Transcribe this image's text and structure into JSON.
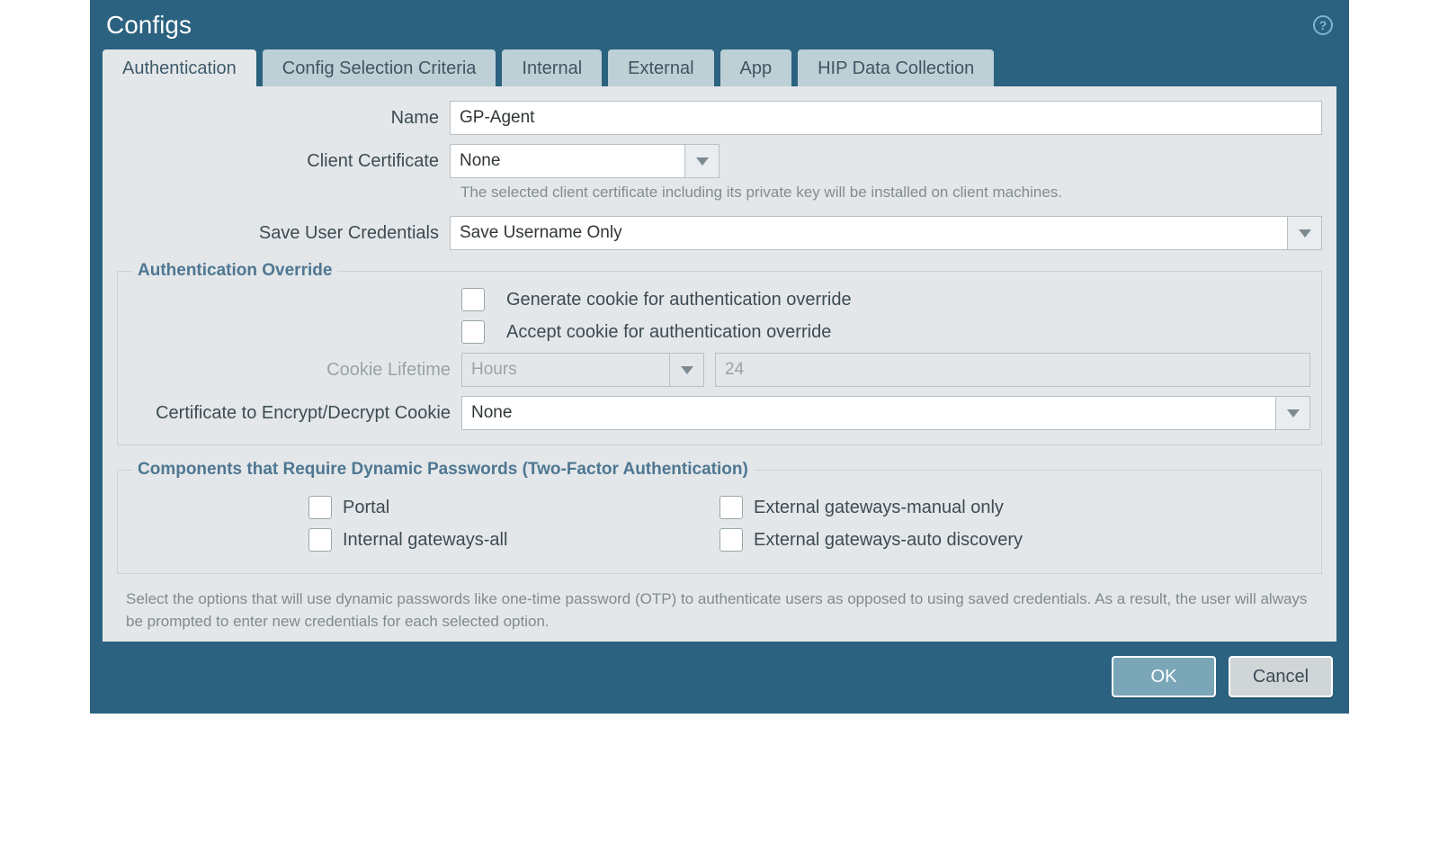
{
  "dialog": {
    "title": "Configs"
  },
  "tabs": [
    {
      "id": "authentication",
      "label": "Authentication",
      "active": true
    },
    {
      "id": "config-selection-criteria",
      "label": "Config Selection Criteria"
    },
    {
      "id": "internal",
      "label": "Internal"
    },
    {
      "id": "external",
      "label": "External"
    },
    {
      "id": "app",
      "label": "App"
    },
    {
      "id": "hip",
      "label": "HIP Data Collection"
    }
  ],
  "form": {
    "name_label": "Name",
    "name_value": "GP-Agent",
    "client_cert_label": "Client Certificate",
    "client_cert_value": "None",
    "client_cert_hint": "The selected client certificate including its private key will be installed on client machines.",
    "save_creds_label": "Save User Credentials",
    "save_creds_value": "Save Username Only"
  },
  "auth_override": {
    "legend": "Authentication Override",
    "generate_cookie": "Generate cookie for authentication override",
    "accept_cookie": "Accept cookie for authentication override",
    "cookie_lifetime_label": "Cookie Lifetime",
    "cookie_lifetime_unit": "Hours",
    "cookie_lifetime_value": "24",
    "cert_cookie_label": "Certificate to Encrypt/Decrypt Cookie",
    "cert_cookie_value": "None"
  },
  "two_factor": {
    "legend": "Components that Require Dynamic Passwords (Two-Factor Authentication)",
    "portal": "Portal",
    "internal_all": "Internal gateways-all",
    "external_manual": "External gateways-manual only",
    "external_auto": "External gateways-auto discovery"
  },
  "description": "Select the options that will use dynamic passwords like one-time password (OTP) to authenticate users as opposed to using saved credentials. As a result, the user will always be prompted to enter new credentials for each selected option.",
  "buttons": {
    "ok": "OK",
    "cancel": "Cancel"
  }
}
